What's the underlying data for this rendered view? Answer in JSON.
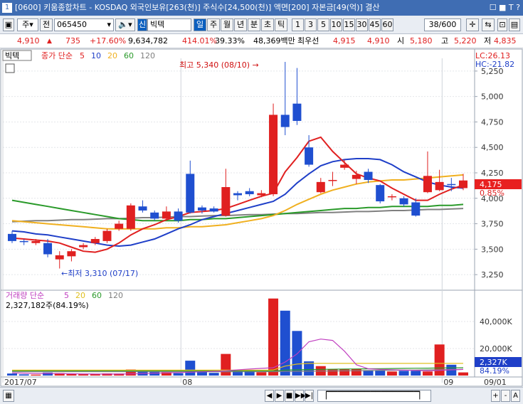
{
  "titlebar": {
    "window_number": "1",
    "title": "[0600] 키움종합차트 - KOSDAQ 외국인보유[263(천)] 주식수[24,500(천)] 액면[200] 자본금[49(억)] 결산",
    "controls": "☐ ■ T ?"
  },
  "toolbar": {
    "market": "주",
    "period_prefix": "전",
    "code": "065450",
    "tag": "신",
    "stock_name": "빅텍",
    "periods": [
      "일",
      "주",
      "월",
      "년",
      "분",
      "초",
      "틱"
    ],
    "selected_period": "일",
    "intervals": [
      "1",
      "3",
      "5",
      "10",
      "15",
      "30",
      "45",
      "60"
    ],
    "page_count": "38/600"
  },
  "quote": {
    "price": "4,910",
    "change": "735",
    "change_pct": "+17.60%",
    "volume": "9,634,782",
    "volume_ratio": "414.01%",
    "turnover": "39.33%",
    "amount": "48,369백만",
    "bid_label": "최우선",
    "ask": "4,915",
    "bid": "4,910",
    "open_label": "시",
    "open": "5,180",
    "high_label": "고",
    "high": "5,220",
    "low_label": "저",
    "low": "4,835"
  },
  "price_panel": {
    "stock_label": "빅텍",
    "legend_prefix": "종가 단순",
    "ma_periods": [
      "5",
      "10",
      "20",
      "60",
      "120"
    ],
    "ma_colors": [
      "#e02020",
      "#1f3fc8",
      "#f0b020",
      "#2a9a2a",
      "#808080"
    ],
    "lc": "LC:26.13",
    "hc": "HC:-21.82",
    "current_price": "4,175",
    "current_pct": "0.85%",
    "high_annotation": "최고 5,340 (08/10) →",
    "low_annotation": "←최저 3,310 (07/17)"
  },
  "volume_panel": {
    "legend_prefix": "거래량 단순",
    "ma_periods": [
      "5",
      "20",
      "60",
      "120"
    ],
    "ma_colors": [
      "#c040c0",
      "#e0c020",
      "#2a9a2a",
      "#808080"
    ],
    "value_text": "2,327,182주(84.19%)",
    "current_volume": "2,327K",
    "current_pct": "84.19%"
  },
  "chart_data": {
    "type": "candlestick",
    "price_axis": {
      "min": 3125,
      "max": 5375,
      "ticks": [
        3250,
        3500,
        3750,
        4000,
        4250,
        4500,
        4750,
        5000,
        5250
      ],
      "tick_labels": [
        "3,250",
        "3,500",
        "3,750",
        "4,000",
        "4,250",
        "4,500",
        "4,750",
        "5,000",
        "5,250"
      ]
    },
    "volume_axis": {
      "min": 0,
      "max": 60000,
      "ticks": [
        20000,
        40000
      ],
      "tick_labels": [
        "20,000K",
        "40,000K"
      ]
    },
    "date_labels": [
      {
        "index": 0,
        "label": "2017/07"
      },
      {
        "index": 15,
        "label": "08"
      },
      {
        "index": 37,
        "label": "09"
      }
    ],
    "end_date_label": "09/01",
    "candles": [
      {
        "o": 3650,
        "c": 3580,
        "h": 3680,
        "l": 3560,
        "v": 1500
      },
      {
        "o": 3580,
        "c": 3570,
        "h": 3600,
        "l": 3540,
        "v": 900
      },
      {
        "o": 3560,
        "c": 3580,
        "h": 3600,
        "l": 3540,
        "v": 700
      },
      {
        "o": 3560,
        "c": 3450,
        "h": 3600,
        "l": 3420,
        "v": 2200
      },
      {
        "o": 3400,
        "c": 3440,
        "h": 3480,
        "l": 3310,
        "v": 1800
      },
      {
        "o": 3430,
        "c": 3480,
        "h": 3500,
        "l": 3380,
        "v": 1400
      },
      {
        "o": 3520,
        "c": 3540,
        "h": 3560,
        "l": 3500,
        "v": 1000
      },
      {
        "o": 3560,
        "c": 3600,
        "h": 3620,
        "l": 3540,
        "v": 1200
      },
      {
        "o": 3580,
        "c": 3680,
        "h": 3700,
        "l": 3560,
        "v": 1600
      },
      {
        "o": 3700,
        "c": 3750,
        "h": 3780,
        "l": 3680,
        "v": 1500
      },
      {
        "o": 3700,
        "c": 3930,
        "h": 3950,
        "l": 3680,
        "v": 4500
      },
      {
        "o": 3920,
        "c": 3880,
        "h": 3980,
        "l": 3860,
        "v": 4000
      },
      {
        "o": 3860,
        "c": 3800,
        "h": 3880,
        "l": 3780,
        "v": 3000
      },
      {
        "o": 3800,
        "c": 3870,
        "h": 3920,
        "l": 3780,
        "v": 2500
      },
      {
        "o": 3870,
        "c": 3780,
        "h": 3900,
        "l": 3760,
        "v": 1800
      },
      {
        "o": 4240,
        "c": 3860,
        "h": 4370,
        "l": 3850,
        "v": 11000
      },
      {
        "o": 3910,
        "c": 3880,
        "h": 3930,
        "l": 3850,
        "v": 3000
      },
      {
        "o": 3900,
        "c": 3870,
        "h": 3920,
        "l": 3860,
        "v": 2000
      },
      {
        "o": 3830,
        "c": 4110,
        "h": 4290,
        "l": 3820,
        "v": 16000
      },
      {
        "o": 4050,
        "c": 4030,
        "h": 4070,
        "l": 3980,
        "v": 4000
      },
      {
        "o": 4070,
        "c": 4040,
        "h": 4100,
        "l": 4020,
        "v": 3500
      },
      {
        "o": 4030,
        "c": 4050,
        "h": 4080,
        "l": 4010,
        "v": 2500
      },
      {
        "o": 4040,
        "c": 4820,
        "h": 4930,
        "l": 4020,
        "v": 57000
      },
      {
        "o": 4820,
        "c": 4700,
        "h": 5340,
        "l": 4620,
        "v": 48000
      },
      {
        "o": 4930,
        "c": 4760,
        "h": 5280,
        "l": 4720,
        "v": 33000
      },
      {
        "o": 4500,
        "c": 4330,
        "h": 4620,
        "l": 4310,
        "v": 10500
      },
      {
        "o": 4060,
        "c": 4160,
        "h": 4200,
        "l": 4050,
        "v": 7000
      },
      {
        "o": 4170,
        "c": 4180,
        "h": 4260,
        "l": 4120,
        "v": 4500
      },
      {
        "o": 4300,
        "c": 4330,
        "h": 4380,
        "l": 4280,
        "v": 4500
      },
      {
        "o": 4190,
        "c": 4230,
        "h": 4270,
        "l": 4140,
        "v": 5000
      },
      {
        "o": 4260,
        "c": 4180,
        "h": 4290,
        "l": 4150,
        "v": 4000
      },
      {
        "o": 4130,
        "c": 3970,
        "h": 4140,
        "l": 3950,
        "v": 4000
      },
      {
        "o": 4010,
        "c": 4020,
        "h": 4040,
        "l": 3980,
        "v": 3000
      },
      {
        "o": 4000,
        "c": 3940,
        "h": 4020,
        "l": 3920,
        "v": 3500
      },
      {
        "o": 3960,
        "c": 3830,
        "h": 4000,
        "l": 3820,
        "v": 3500
      },
      {
        "o": 4060,
        "c": 4220,
        "h": 4460,
        "l": 4050,
        "v": 3000
      },
      {
        "o": 4080,
        "c": 4160,
        "h": 4280,
        "l": 4070,
        "v": 23000
      },
      {
        "o": 4140,
        "c": 4130,
        "h": 4200,
        "l": 4070,
        "v": 8000
      },
      {
        "o": 4100,
        "c": 4175,
        "h": 4240,
        "l": 4080,
        "v": 2327
      }
    ],
    "ma5": [
      3610,
      3600,
      3590,
      3580,
      3560,
      3520,
      3480,
      3470,
      3500,
      3560,
      3640,
      3700,
      3740,
      3790,
      3820,
      3860,
      3870,
      3880,
      3900,
      3940,
      3980,
      4020,
      4050,
      4260,
      4400,
      4560,
      4600,
      4460,
      4350,
      4240,
      4200,
      4170,
      4100,
      4040,
      3980,
      3980,
      4040,
      4090,
      4130
    ],
    "ma10": [
      3680,
      3670,
      3650,
      3640,
      3620,
      3600,
      3580,
      3560,
      3540,
      3530,
      3540,
      3570,
      3600,
      3650,
      3700,
      3740,
      3790,
      3820,
      3850,
      3880,
      3910,
      3940,
      3970,
      4040,
      4150,
      4240,
      4320,
      4360,
      4380,
      4390,
      4390,
      4380,
      4330,
      4260,
      4210,
      4160,
      4130,
      4110,
      4100
    ],
    "ma20": [
      3780,
      3770,
      3760,
      3750,
      3740,
      3730,
      3720,
      3710,
      3700,
      3700,
      3700,
      3700,
      3700,
      3710,
      3710,
      3720,
      3720,
      3730,
      3740,
      3760,
      3780,
      3800,
      3830,
      3880,
      3940,
      3990,
      4040,
      4080,
      4110,
      4140,
      4160,
      4170,
      4180,
      4180,
      4190,
      4200,
      4210,
      4220,
      4230
    ],
    "ma60": [
      3980,
      3960,
      3940,
      3920,
      3900,
      3880,
      3860,
      3840,
      3820,
      3800,
      3790,
      3780,
      3780,
      3780,
      3780,
      3790,
      3790,
      3800,
      3800,
      3810,
      3820,
      3830,
      3840,
      3850,
      3860,
      3870,
      3880,
      3890,
      3900,
      3900,
      3910,
      3910,
      3920,
      3920,
      3920,
      3920,
      3930,
      3930,
      3940
    ],
    "ma120": [
      3770,
      3775,
      3780,
      3780,
      3785,
      3790,
      3790,
      3795,
      3800,
      3800,
      3805,
      3810,
      3810,
      3815,
      3820,
      3820,
      3825,
      3830,
      3830,
      3835,
      3840,
      3840,
      3845,
      3850,
      3850,
      3855,
      3860,
      3860,
      3865,
      3870,
      3870,
      3875,
      3880,
      3880,
      3885,
      3890,
      3890,
      3895,
      3900
    ],
    "vma5": [
      2000,
      1800,
      1600,
      1500,
      1400,
      1300,
      1200,
      1150,
      1100,
      1100,
      1200,
      1400,
      1700,
      2000,
      2200,
      2500,
      2800,
      3100,
      3500,
      4200,
      4800,
      5300,
      5800,
      10000,
      16000,
      25000,
      27000,
      26000,
      18000,
      8000,
      5000,
      4500,
      4300,
      4000,
      3800,
      3500,
      3800,
      4200,
      4500
    ],
    "vma20": [
      4000,
      4000,
      4000,
      4000,
      4000,
      4000,
      4000,
      4000,
      4000,
      4000,
      4000,
      4000,
      4000,
      4000,
      4000,
      4000,
      4000,
      4000,
      4000,
      4000,
      4000,
      4000,
      4100,
      7000,
      8500,
      9000,
      9000,
      9000,
      9000,
      9000,
      9000,
      9000,
      9000,
      9000,
      9000,
      9000,
      9000,
      9000,
      9000
    ],
    "vma60": [
      3500,
      3500,
      3500,
      3500,
      3500,
      3500,
      3500,
      3500,
      3500,
      3500,
      3500,
      3500,
      3500,
      3500,
      3500,
      3500,
      3500,
      3500,
      3500,
      3500,
      3500,
      3500,
      3600,
      4000,
      4200,
      4400,
      4600,
      4700,
      4800,
      4900,
      5000,
      5100,
      5200,
      5300,
      5400,
      5500,
      5600,
      5700,
      5800
    ],
    "vma120": [
      2800,
      2800,
      2800,
      2800,
      2800,
      2800,
      2800,
      2800,
      2800,
      2800,
      2800,
      2800,
      2800,
      2800,
      2800,
      2800,
      2800,
      2800,
      2800,
      2800,
      2800,
      2800,
      2900,
      3000,
      3100,
      3200,
      3300,
      3400,
      3500,
      3600,
      3700,
      3800,
      3900,
      4000,
      4100,
      4200,
      4300,
      4400,
      4500
    ]
  },
  "status": {
    "nav_buttons": [
      "◀",
      "▶",
      "■",
      "▶▶",
      "▶|"
    ],
    "right_buttons": [
      "+",
      "-",
      "A"
    ]
  }
}
